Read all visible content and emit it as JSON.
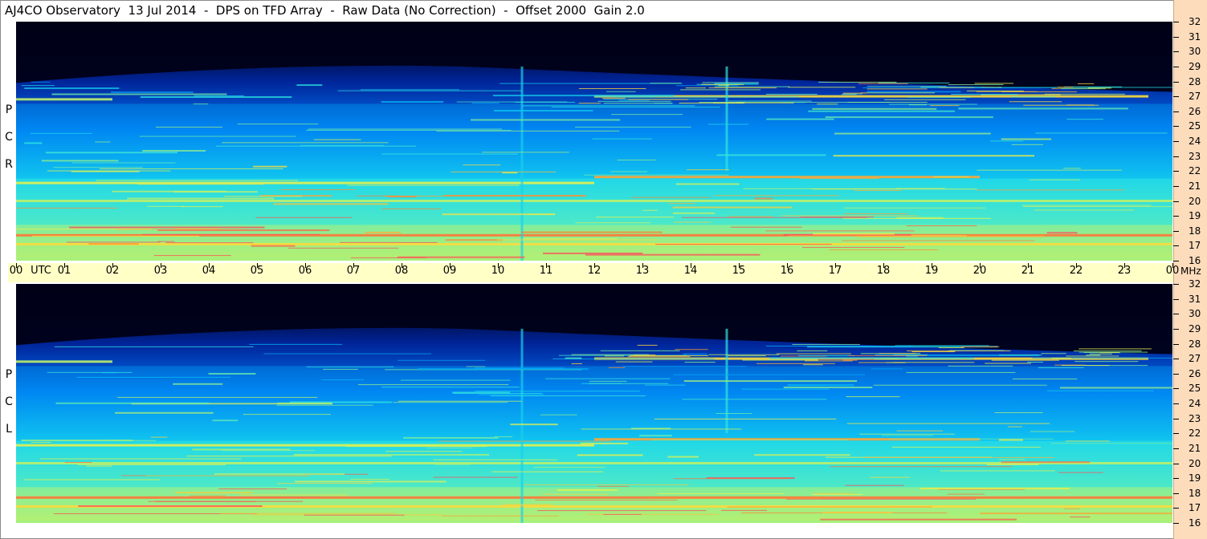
{
  "title": "AJ4CO Observatory  13 Jul 2014  -  DPS on TFD Array  -  Raw Data (No Correction)  -  Offset 2000  Gain 2.0",
  "colors": {
    "background": "#ffffff",
    "time_bar": "#ffffc6",
    "freq_strip": "#fddcbc"
  },
  "chart_data": [
    {
      "type": "heatmap",
      "panel": "top",
      "polarization_label": [
        "R",
        "C",
        "P"
      ],
      "x_axis": {
        "unit": "UTC",
        "range_hours": [
          0,
          24
        ],
        "tick_labels": [
          "00",
          "01",
          "02",
          "03",
          "04",
          "05",
          "06",
          "07",
          "08",
          "09",
          "10",
          "11",
          "12",
          "13",
          "14",
          "15",
          "16",
          "17",
          "18",
          "19",
          "20",
          "21",
          "22",
          "23",
          "00"
        ]
      },
      "y_axis": {
        "unit": "MHz",
        "range": [
          16,
          32
        ],
        "tick_labels": [
          "16",
          "17",
          "18",
          "19",
          "20",
          "21",
          "22",
          "23",
          "24",
          "25",
          "26",
          "27",
          "28",
          "29",
          "30",
          "31",
          "32"
        ]
      },
      "colormap": [
        "#000010",
        "#00105a",
        "#0030c0",
        "#0070f0",
        "#00b8f8",
        "#30e8e0",
        "#a0f080",
        "#f8f040",
        "#ff8030",
        "#ff2080"
      ],
      "intensity_features": [
        {
          "kind": "band",
          "mhz": [
            16.2,
            18.4
          ],
          "level": 0.72
        },
        {
          "kind": "band",
          "mhz": [
            18.4,
            21.5
          ],
          "level": 0.55
        },
        {
          "kind": "band",
          "mhz": [
            21.5,
            26.5
          ],
          "level": 0.42
        },
        {
          "kind": "line",
          "mhz": 17.7,
          "utc": [
            0,
            24
          ],
          "level": 0.9
        },
        {
          "kind": "line",
          "mhz": 17.1,
          "utc": [
            0,
            24
          ],
          "level": 0.8
        },
        {
          "kind": "line",
          "mhz": 21.2,
          "utc": [
            0,
            12
          ],
          "level": 0.75
        },
        {
          "kind": "line",
          "mhz": 21.6,
          "utc": [
            12,
            20
          ],
          "level": 0.85
        },
        {
          "kind": "line",
          "mhz": 20.0,
          "utc": [
            0,
            24
          ],
          "level": 0.7
        },
        {
          "kind": "line",
          "mhz": 27.0,
          "utc": [
            12,
            23.5
          ],
          "level": 0.8
        },
        {
          "kind": "line",
          "mhz": 26.8,
          "utc": [
            0,
            2
          ],
          "level": 0.7
        },
        {
          "kind": "spike",
          "utc": 14.75,
          "mhz": [
            22,
            29
          ],
          "level": 0.55
        },
        {
          "kind": "spike",
          "utc": 10.5,
          "mhz": [
            16,
            29
          ],
          "level": 0.5
        }
      ]
    },
    {
      "type": "heatmap",
      "panel": "bottom",
      "polarization_label": [
        "L",
        "C",
        "P"
      ],
      "x_axis": {
        "unit": "UTC",
        "range_hours": [
          0,
          24
        ],
        "tick_labels": [
          "00",
          "01",
          "02",
          "03",
          "04",
          "05",
          "06",
          "07",
          "08",
          "09",
          "10",
          "11",
          "12",
          "13",
          "14",
          "15",
          "16",
          "17",
          "18",
          "19",
          "20",
          "21",
          "22",
          "23",
          "00"
        ]
      },
      "y_axis": {
        "unit": "MHz",
        "range": [
          16,
          32
        ],
        "tick_labels": [
          "16",
          "17",
          "18",
          "19",
          "20",
          "21",
          "22",
          "23",
          "24",
          "25",
          "26",
          "27",
          "28",
          "29",
          "30",
          "31",
          "32"
        ]
      },
      "colormap": [
        "#000010",
        "#00105a",
        "#0030c0",
        "#0070f0",
        "#00b8f8",
        "#30e8e0",
        "#a0f080",
        "#f8f040",
        "#ff8030",
        "#ff2080"
      ],
      "intensity_features": [
        {
          "kind": "band",
          "mhz": [
            16.2,
            18.4
          ],
          "level": 0.72
        },
        {
          "kind": "band",
          "mhz": [
            18.4,
            21.5
          ],
          "level": 0.55
        },
        {
          "kind": "band",
          "mhz": [
            21.5,
            26.5
          ],
          "level": 0.42
        },
        {
          "kind": "line",
          "mhz": 17.7,
          "utc": [
            0,
            24
          ],
          "level": 0.9
        },
        {
          "kind": "line",
          "mhz": 17.1,
          "utc": [
            0,
            24
          ],
          "level": 0.8
        },
        {
          "kind": "line",
          "mhz": 21.2,
          "utc": [
            0,
            12
          ],
          "level": 0.75
        },
        {
          "kind": "line",
          "mhz": 21.6,
          "utc": [
            12,
            20
          ],
          "level": 0.85
        },
        {
          "kind": "line",
          "mhz": 20.0,
          "utc": [
            0,
            24
          ],
          "level": 0.7
        },
        {
          "kind": "line",
          "mhz": 27.0,
          "utc": [
            12,
            23.5
          ],
          "level": 0.8
        },
        {
          "kind": "line",
          "mhz": 26.8,
          "utc": [
            0,
            2
          ],
          "level": 0.7
        },
        {
          "kind": "spike",
          "utc": 14.75,
          "mhz": [
            22,
            29
          ],
          "level": 0.55
        },
        {
          "kind": "spike",
          "utc": 10.5,
          "mhz": [
            16,
            29
          ],
          "level": 0.5
        }
      ]
    }
  ],
  "time_axis": {
    "utc_label": "UTC",
    "mhz_label": "MHz"
  }
}
